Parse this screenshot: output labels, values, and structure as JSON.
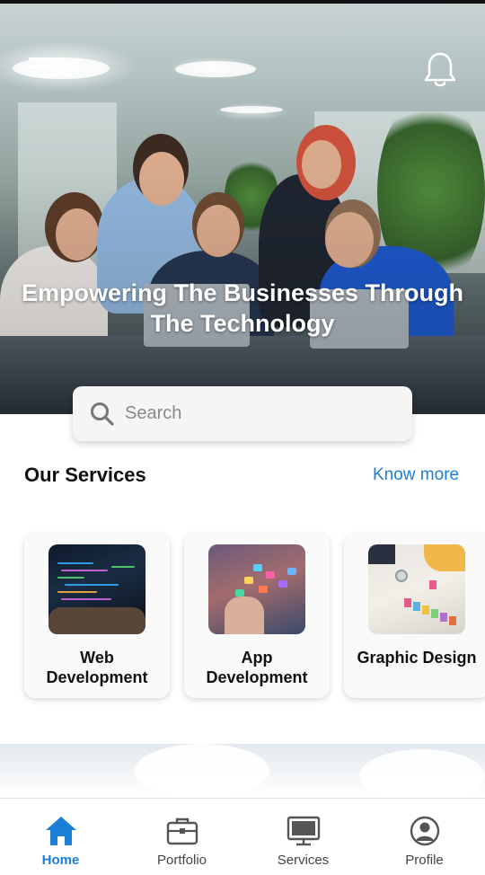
{
  "header": {
    "menu_icon": "hamburger-menu-icon",
    "notification_icon": "bell-icon",
    "hero_title_line1": "Empowering The Businesses Through",
    "hero_title_line2": "The Technology"
  },
  "search": {
    "placeholder": "Search",
    "value": "",
    "icon": "search-icon"
  },
  "services": {
    "title": "Our Services",
    "know_more": "Know more",
    "items": [
      {
        "label_line1": "Web",
        "label_line2": "Development",
        "image": "web-development-image"
      },
      {
        "label_line1": "App",
        "label_line2": "Development",
        "image": "app-development-image"
      },
      {
        "label_line1": "Graphic Design",
        "label_line2": "",
        "image": "graphic-design-image"
      }
    ]
  },
  "tabbar": {
    "active": "Home",
    "active_color": "#1c7fd6",
    "items": [
      {
        "label": "Home",
        "icon": "home-icon"
      },
      {
        "label": "Portfolio",
        "icon": "briefcase-icon"
      },
      {
        "label": "Services",
        "icon": "monitor-icon"
      },
      {
        "label": "Profile",
        "icon": "user-circle-icon"
      }
    ]
  }
}
